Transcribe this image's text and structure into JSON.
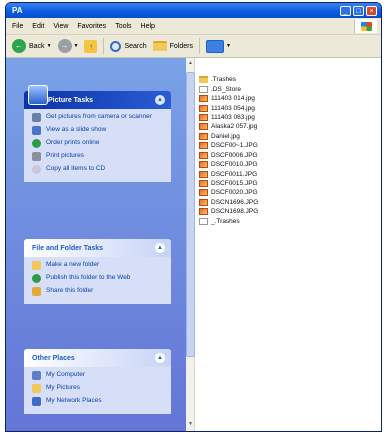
{
  "window": {
    "title": "PA"
  },
  "titlebar": {
    "minimize_glyph": "_",
    "maximize_glyph": "□",
    "close_glyph": "×"
  },
  "menubar": {
    "items": [
      "File",
      "Edit",
      "View",
      "Favorites",
      "Tools",
      "Help"
    ]
  },
  "toolbar": {
    "back_label": "Back",
    "search_label": "Search",
    "folders_label": "Folders"
  },
  "panels": {
    "picture_tasks": {
      "title": "Picture Tasks",
      "items": [
        {
          "label": "Get pictures from camera or scanner",
          "icon": "camera-icon"
        },
        {
          "label": "View as a slide show",
          "icon": "slideshow-icon"
        },
        {
          "label": "Order prints online",
          "icon": "globe-icon"
        },
        {
          "label": "Print pictures",
          "icon": "printer-icon"
        },
        {
          "label": "Copy all items to CD",
          "icon": "cd-icon"
        }
      ]
    },
    "file_folder_tasks": {
      "title": "File and Folder Tasks",
      "items": [
        {
          "label": "Make a new folder",
          "icon": "new-folder-icon"
        },
        {
          "label": "Publish this folder to the Web",
          "icon": "globe-icon"
        },
        {
          "label": "Share this folder",
          "icon": "share-folder-icon"
        }
      ]
    },
    "other_places": {
      "title": "Other Places",
      "items": [
        {
          "label": "My Computer",
          "icon": "computer-icon"
        },
        {
          "label": "My Pictures",
          "icon": "pictures-folder-icon"
        },
        {
          "label": "My Network Places",
          "icon": "network-icon"
        }
      ]
    }
  },
  "files": [
    {
      "name": ".Trashes",
      "type": "folder"
    },
    {
      "name": ".DS_Store",
      "type": "plain"
    },
    {
      "name": "111403 014.jpg",
      "type": "jpg"
    },
    {
      "name": "111403 054.jpg",
      "type": "jpg"
    },
    {
      "name": "111403 063.jpg",
      "type": "jpg"
    },
    {
      "name": "Alaska2 057.jpg",
      "type": "jpg"
    },
    {
      "name": "Daniel.jpg",
      "type": "jpg"
    },
    {
      "name": "DSCF00~1.JPG",
      "type": "jpg"
    },
    {
      "name": "DSCF0006.JPG",
      "type": "jpg"
    },
    {
      "name": "DSCF0010.JPG",
      "type": "jpg"
    },
    {
      "name": "DSCF0011.JPG",
      "type": "jpg"
    },
    {
      "name": "DSCF0015.JPG",
      "type": "jpg"
    },
    {
      "name": "DSCF0020.JPG",
      "type": "jpg"
    },
    {
      "name": "DSCN1696.JPG",
      "type": "jpg"
    },
    {
      "name": "DSCN1698.JPG",
      "type": "jpg"
    },
    {
      "name": "_.Trashes",
      "type": "plain"
    }
  ],
  "colors": {
    "titlebar": "#0a5adf",
    "taskpane": "#6375d6",
    "panel_body": "#d6dff7",
    "link": "#0c3fa6"
  }
}
